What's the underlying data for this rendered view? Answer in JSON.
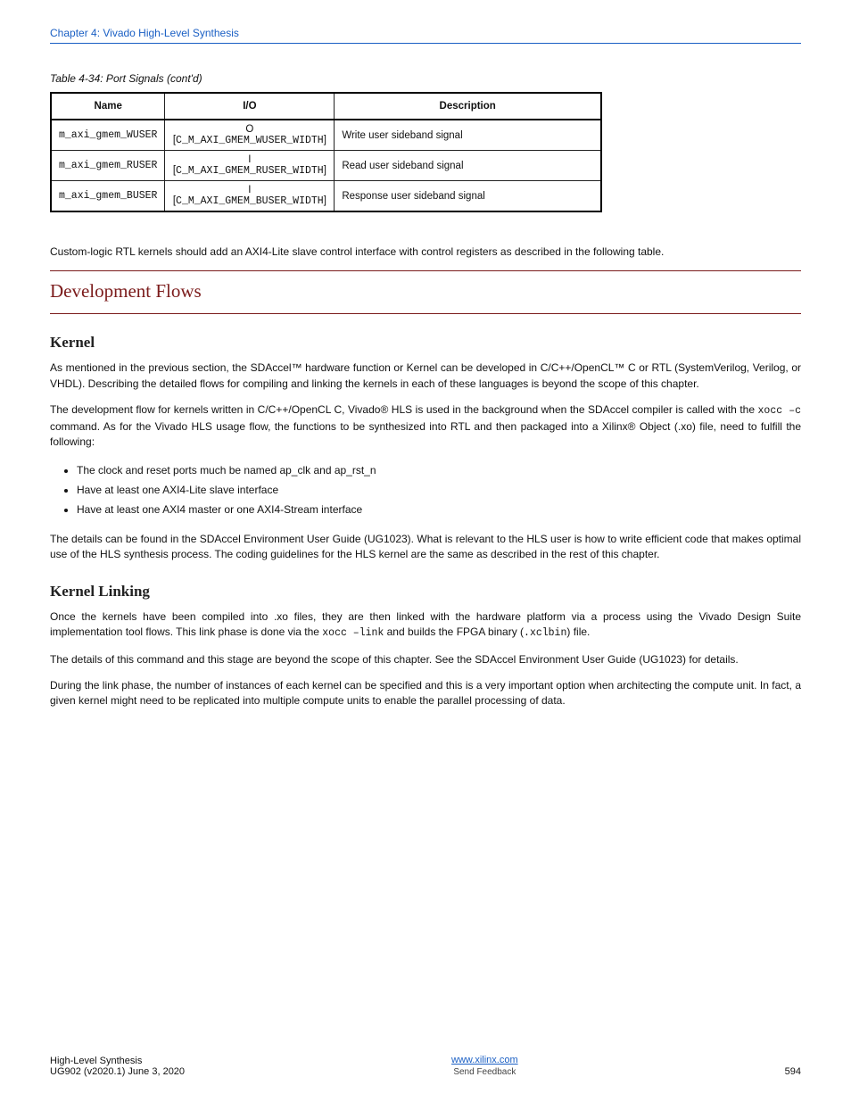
{
  "header": {
    "breadcrumb_link": "Chapter 4: Vivado High-Level Synthesis",
    "table_cont": "Table 4-34: Port Signals (cont'd)"
  },
  "table": {
    "headers": [
      "Name",
      "I/O",
      "Description"
    ],
    "rows": [
      {
        "name": "m_axi_gmem_WUSER",
        "io": "O",
        "iow": "C_M_AXI_GMEM_WUSER_WIDTH",
        "desc": "Write user sideband signal"
      },
      {
        "name": "m_axi_gmem_RUSER",
        "io": "I",
        "iow": "C_M_AXI_GMEM_RUSER_WIDTH",
        "desc": "Read user sideband signal"
      },
      {
        "name": "m_axi_gmem_BUSER",
        "io": "I",
        "iow": "C_M_AXI_GMEM_BUSER_WIDTH",
        "desc": "Response user sideband signal"
      }
    ]
  },
  "registers_p": "Custom-logic RTL kernels should add an AXI4-Lite slave control interface with control registers as described in the following table.",
  "section_title": "Development Flows",
  "sub1": {
    "title": "Kernel",
    "p1": "As mentioned in the previous section, the SDAccel™ hardware function or Kernel can be developed in C/C++/OpenCL™ C or RTL (SystemVerilog, Verilog, or VHDL). Describing the detailed flows for compiling and linking the kernels in each of these languages is beyond the scope of this chapter.",
    "p2_pre": "The development flow for kernels written in C/C++/OpenCL C, Vivado® HLS is used in the background when the SDAccel compiler is called with the ",
    "p2_code": "xocc –c",
    "p2_post": " command. As for the Vivado HLS usage flow, the functions to be synthesized into RTL and then packaged into a Xilinx® Object (.xo) file, need to fulfill the following:",
    "bullets": [
      "The clock and reset ports much be named ap_clk and ap_rst_n",
      "Have at least one AXI4-Lite slave interface",
      "Have at least one AXI4 master or one AXI4-Stream interface"
    ],
    "p3": "The details can be found in the SDAccel Environment User Guide (UG1023). What is relevant to the HLS user is how to write efficient code that makes optimal use of the HLS synthesis process. The coding guidelines for the HLS kernel are the same as described in the rest of this chapter."
  },
  "sub2": {
    "title": "Kernel Linking",
    "p1_pre": "Once the kernels have been compiled into .xo files, they are then linked with the hardware platform via a process using the Vivado Design Suite implementation tool flows. This link phase is done via the ",
    "p1_code1": "xocc –link",
    "p1_mid": " and builds the FPGA binary (",
    "p1_code2": ".xclbin",
    "p1_post": ") file.",
    "p2": "The details of this command and this stage are beyond the scope of this chapter. See the SDAccel Environment User Guide (UG1023) for details.",
    "p3": "During the link phase, the number of instances of each kernel can be specified and this is a very important option when architecting the compute unit. In fact, a given kernel might need to be replicated into multiple compute units to enable the parallel processing of data."
  },
  "footer": {
    "left1": "High-Level Synthesis",
    "left2_pre": "UG902 (v2020.1) June 3, 2020",
    "mid_link": "www.xilinx.com",
    "mid_prompt": "Send Feedback",
    "page": "594"
  }
}
